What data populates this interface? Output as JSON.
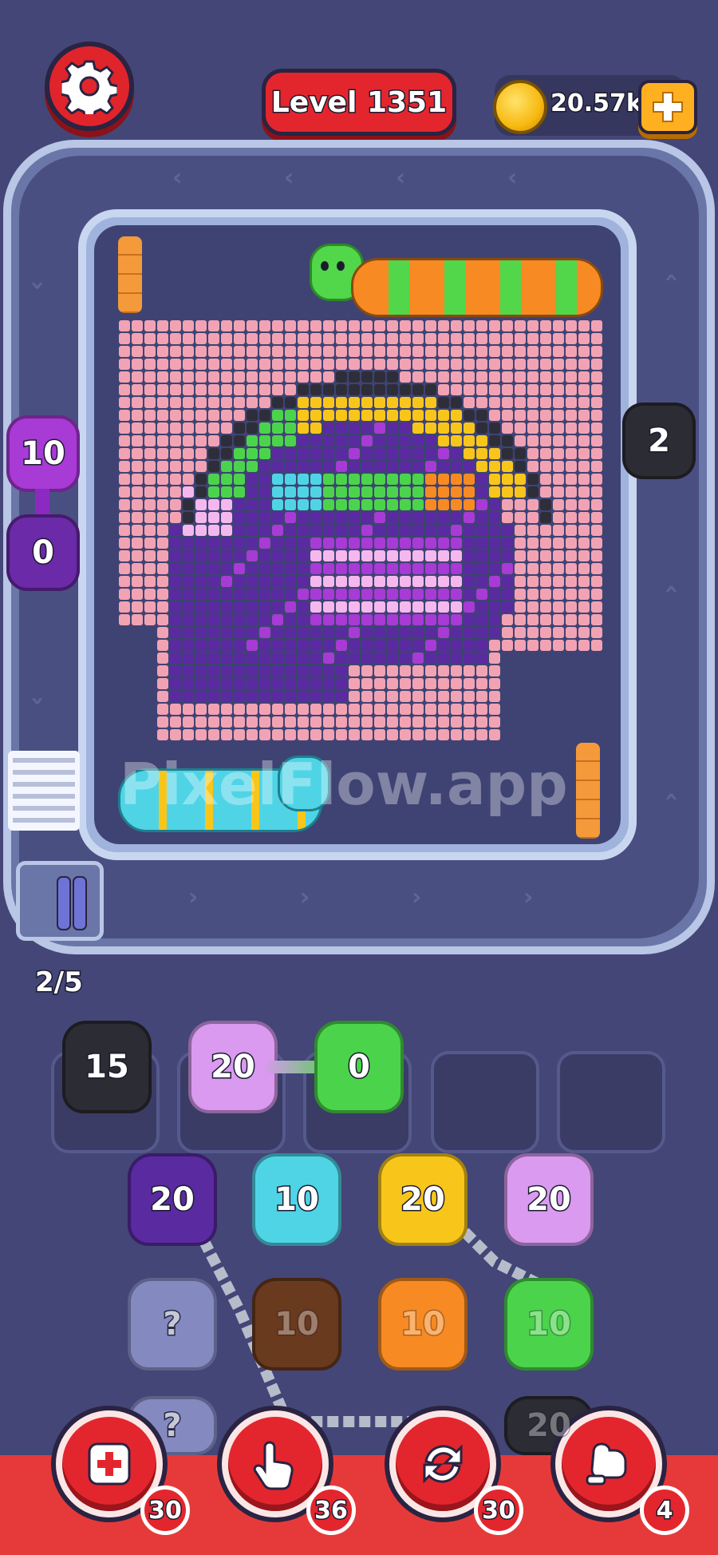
{
  "header": {
    "level_label": "Level 1351",
    "coins": "20.57k"
  },
  "board": {
    "watermark": "PixelFlow.app",
    "progress": "2/5"
  },
  "side_units": [
    {
      "count": "10",
      "color": "#a83ad6"
    },
    {
      "count": "0",
      "color": "#6b2aa8"
    },
    {
      "count": "2",
      "color": "#2c2c34"
    }
  ],
  "slots": [
    {
      "count": "15",
      "color": "#2c2c34",
      "filled": true
    },
    {
      "count": "20",
      "color": "#d99af0",
      "filled": true
    },
    {
      "count": "0",
      "color": "#4bd44b",
      "filled": true
    },
    {
      "count": "",
      "color": "",
      "filled": false
    },
    {
      "count": "",
      "color": "",
      "filled": false
    }
  ],
  "queue": {
    "row1": [
      {
        "count": "20",
        "color": "#5a2aa0"
      },
      {
        "count": "10",
        "color": "#4fd4e6"
      },
      {
        "count": "20",
        "color": "#f8c61a"
      },
      {
        "count": "20",
        "color": "#d99af0"
      }
    ],
    "row2": [
      {
        "count": "?",
        "color": "#a0a8e0"
      },
      {
        "count": "10",
        "color": "#6a3a1e"
      },
      {
        "count": "10",
        "color": "#f78a22"
      },
      {
        "count": "10",
        "color": "#4bd44b"
      }
    ],
    "row3": [
      {
        "count": "?",
        "color": "#a0a8e0"
      },
      {
        "count": "",
        "color": "#a83ad6"
      },
      {
        "count": "",
        "color": "#a83ad6"
      },
      {
        "count": "20",
        "color": "#2c2c34"
      }
    ]
  },
  "tools": [
    {
      "name": "add-slot",
      "count": "30"
    },
    {
      "name": "tap",
      "count": "36"
    },
    {
      "name": "shuffle",
      "count": "30"
    },
    {
      "name": "vacuum",
      "count": "4"
    }
  ],
  "colors": {
    "background": "#434677",
    "accent_red": "#e3262e",
    "gold": "#f7b912"
  }
}
